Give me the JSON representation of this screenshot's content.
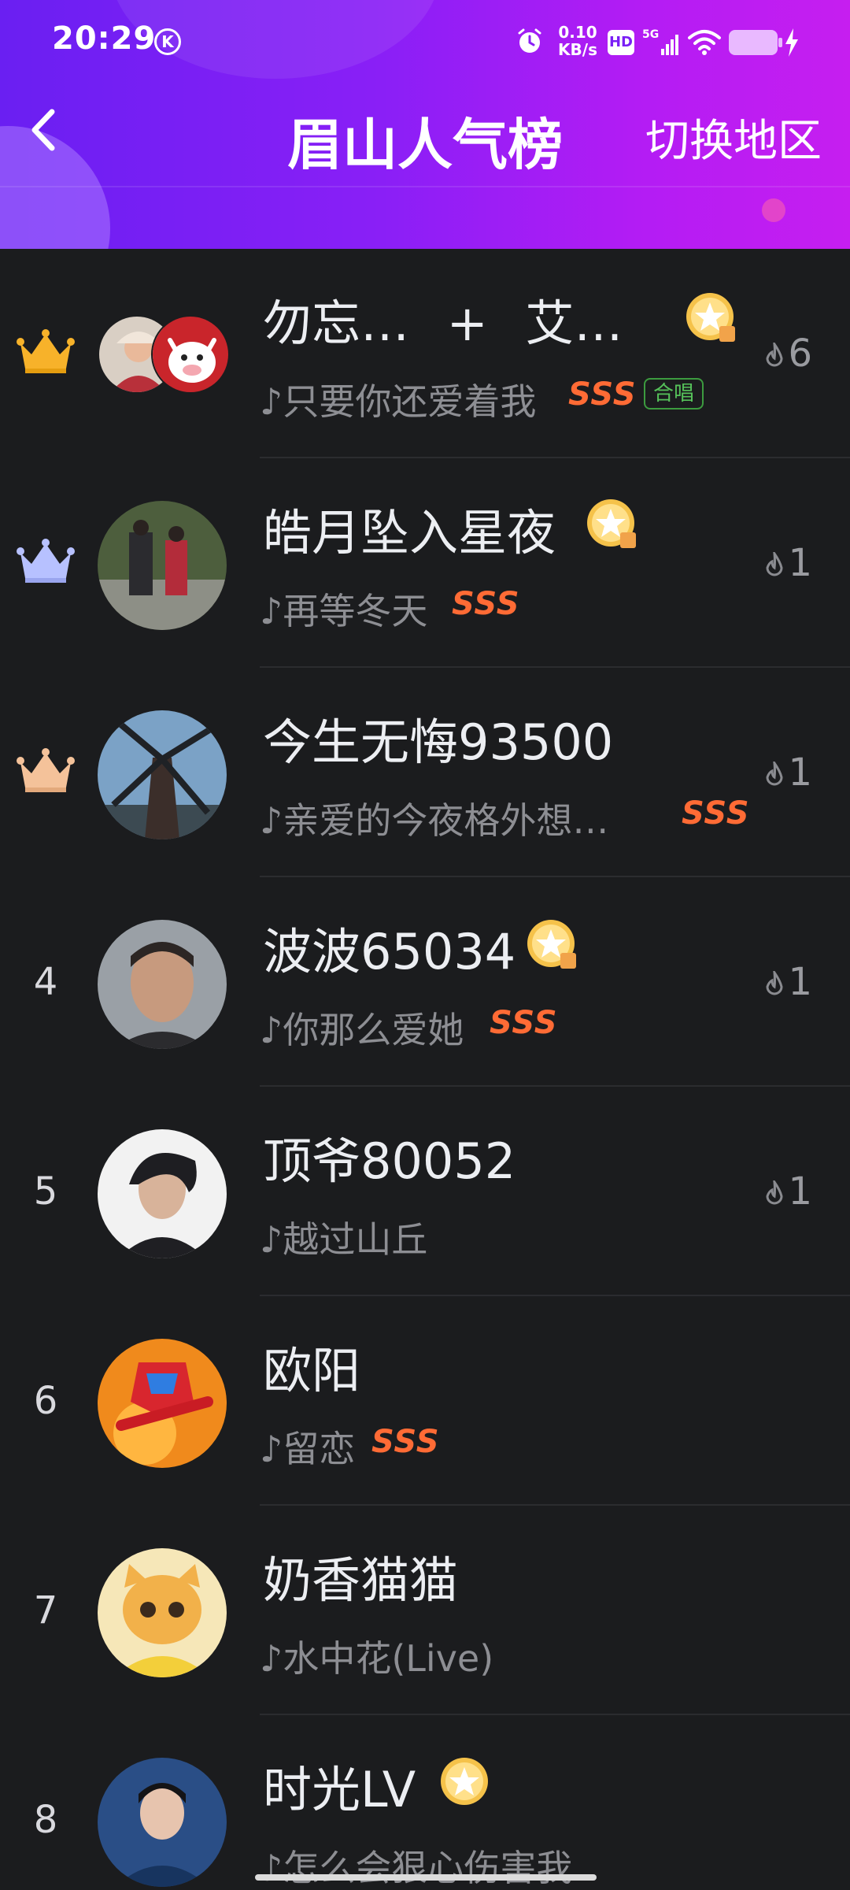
{
  "status_bar": {
    "time": "20:29",
    "k_label": "K",
    "net_speed_value": "0.10",
    "net_speed_unit": "KB/s",
    "hd_label": "HD",
    "network_label": "5G"
  },
  "header": {
    "title": "眉山人气榜",
    "switch_region": "切换地区"
  },
  "colors": {
    "header_gradient_start": "#6a1ff2",
    "header_gradient_end": "#c61ef0",
    "background": "#1b1c1e",
    "sss": "#ff6b35",
    "crown_gold": "#f7b22a",
    "crown_silver": "#b7c1ff",
    "crown_bronze": "#f4c29a"
  },
  "rows": [
    {
      "rank": "",
      "crown": "gold",
      "name_a": "勿忘…",
      "plus": "+",
      "name_b": "艾…",
      "song": "♪只要你还爱着我",
      "sss": "SSS",
      "chorus": "合唱",
      "heat": "6"
    },
    {
      "rank": "",
      "crown": "silver",
      "name": "皓月坠入星夜",
      "song": "♪再等冬天",
      "sss": "SSS",
      "heat": "1"
    },
    {
      "rank": "",
      "crown": "bronze",
      "name": "今生无悔93500",
      "song": "♪亲爱的今夜格外想…",
      "sss": "SSS",
      "heat": "1"
    },
    {
      "rank": "4",
      "name": "波波65034",
      "song": "♪你那么爱她",
      "sss": "SSS",
      "heat": "1"
    },
    {
      "rank": "5",
      "name": "顶爷80052",
      "song": "♪越过山丘",
      "heat": "1"
    },
    {
      "rank": "6",
      "name": "欧阳",
      "song": "♪留恋",
      "sss": "SSS"
    },
    {
      "rank": "7",
      "name": "奶香猫猫",
      "song": "♪水中花(Live)"
    },
    {
      "rank": "8",
      "name": "时光LV",
      "song": "♪怎么会狠心伤害我"
    }
  ]
}
